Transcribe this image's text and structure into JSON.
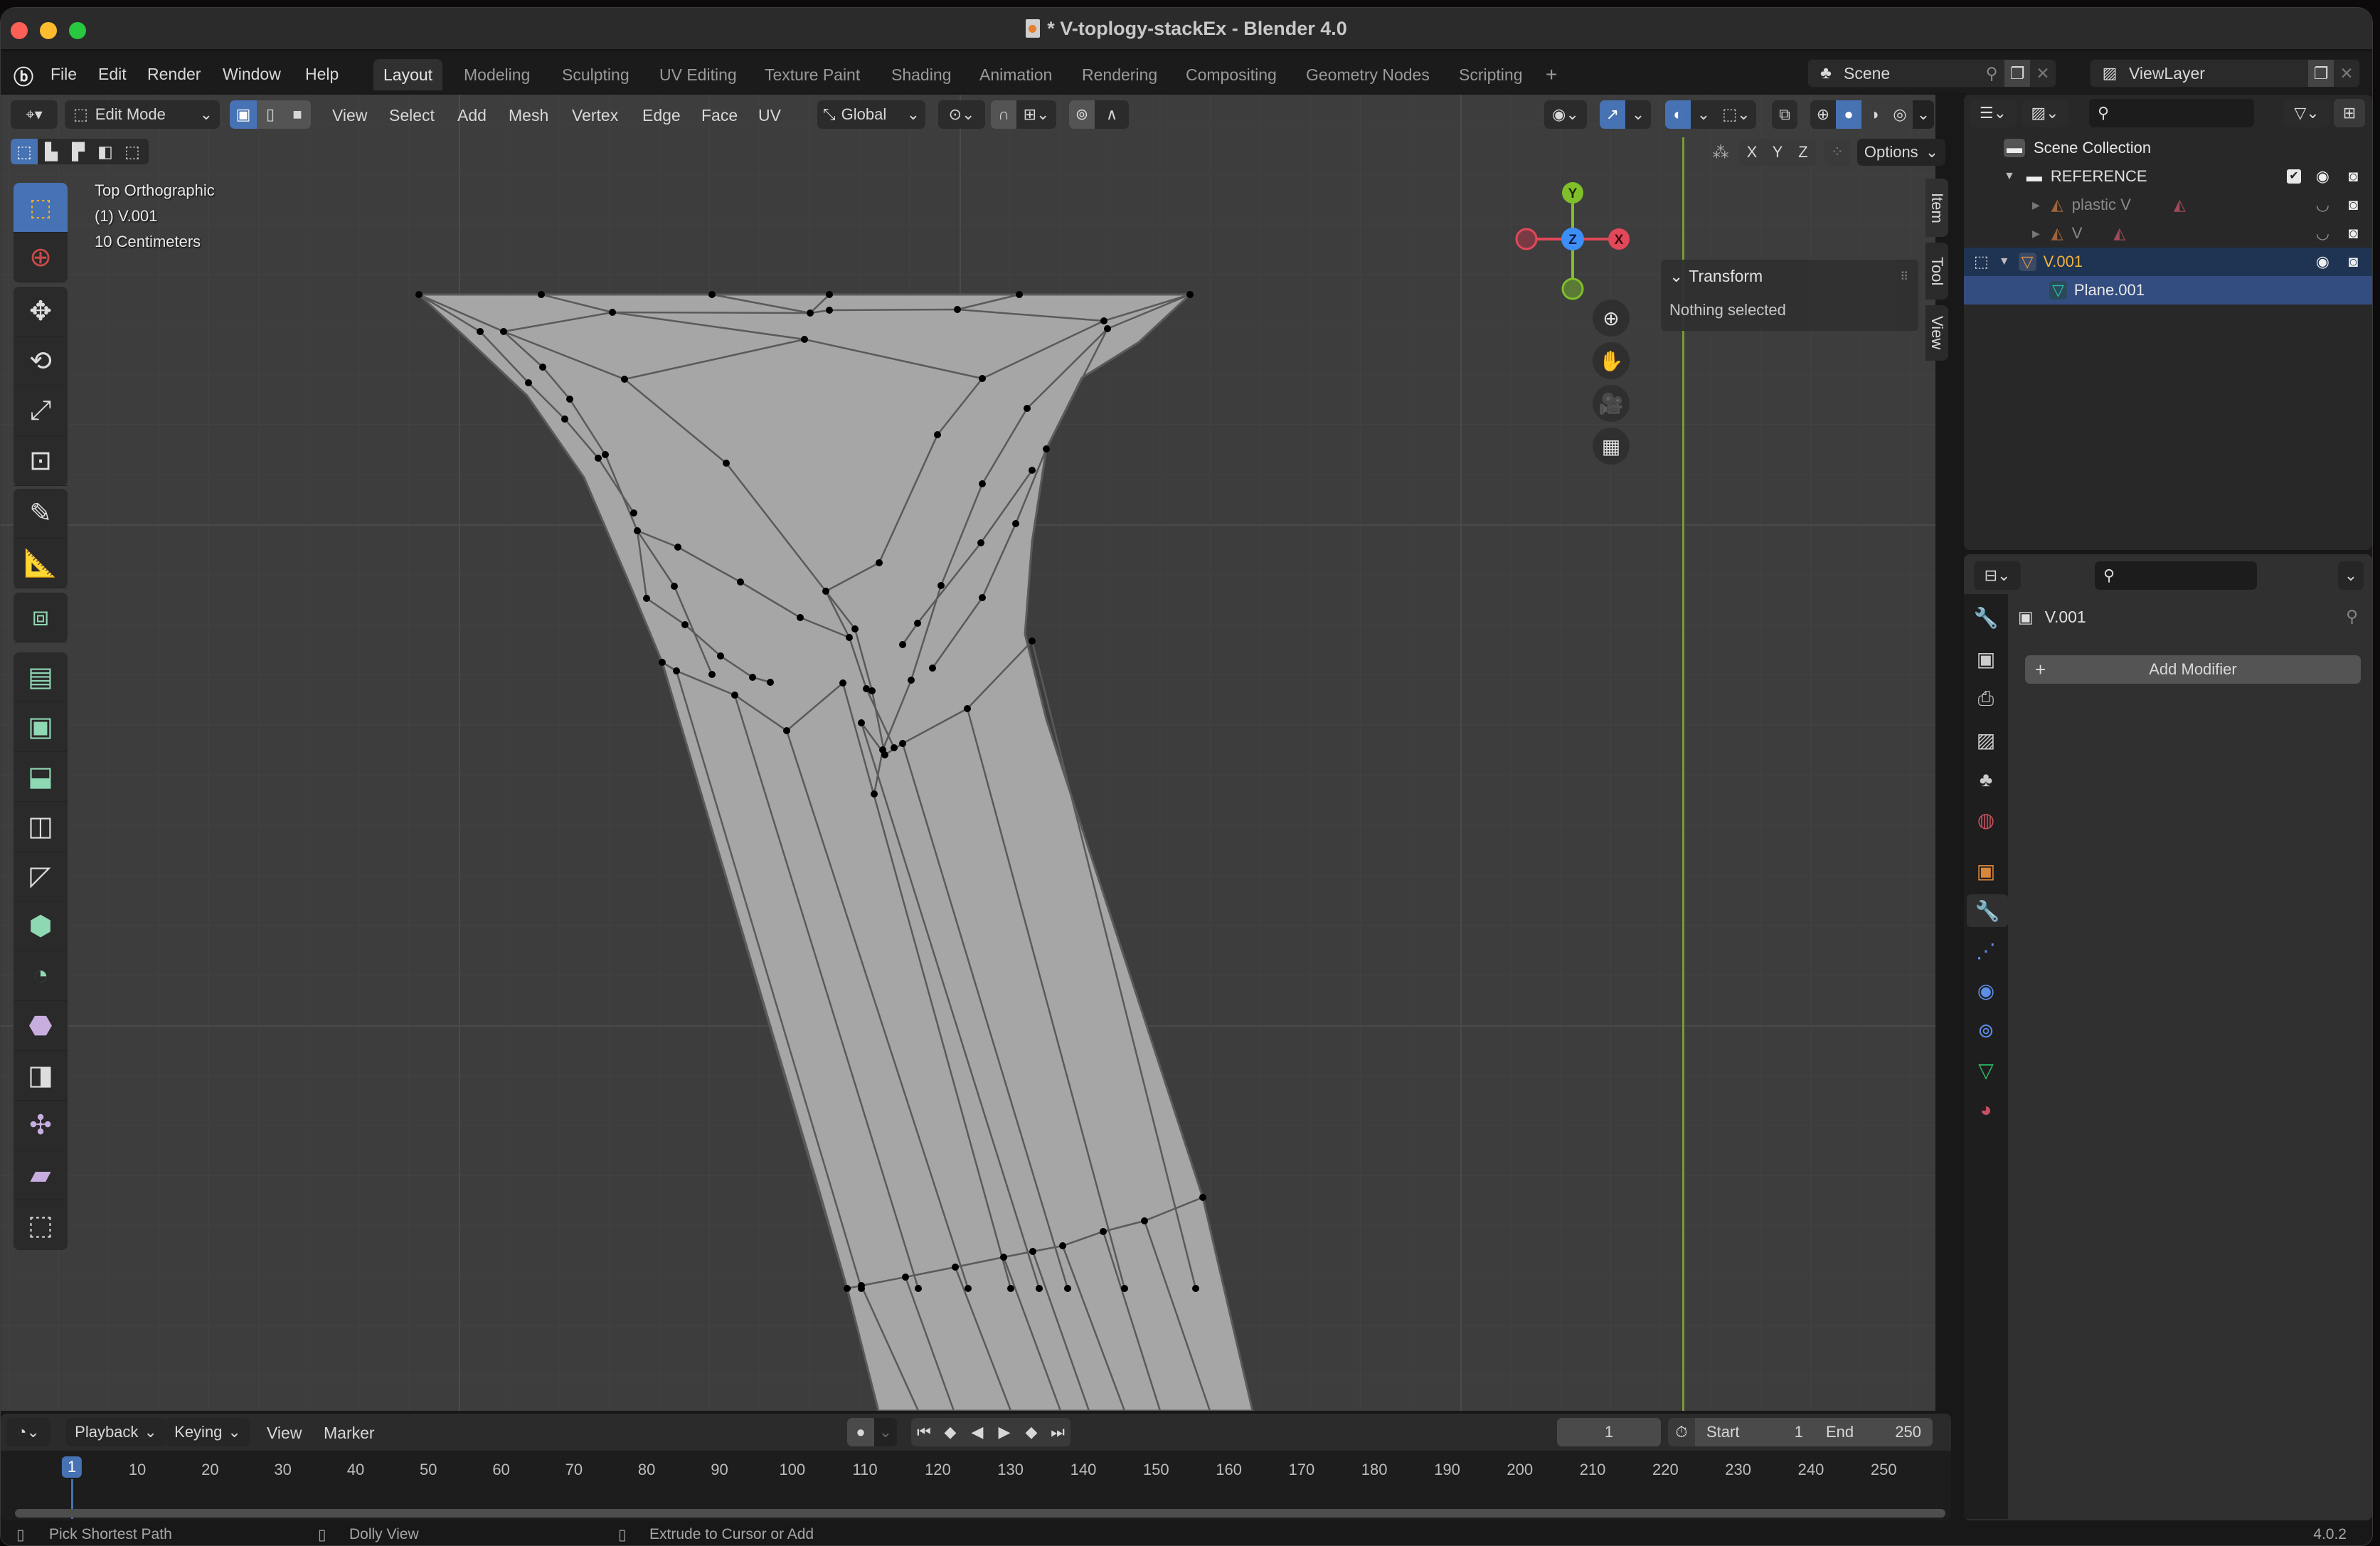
{
  "window": {
    "title": "* V-toplogy-stackEx - Blender 4.0",
    "traffic_lights": {
      "close": "#fe5f57",
      "minimize": "#febc2e",
      "maximize": "#28c840"
    }
  },
  "menubar": {
    "menus": [
      "File",
      "Edit",
      "Render",
      "Window",
      "Help"
    ],
    "workspaces": [
      "Layout",
      "Modeling",
      "Sculpting",
      "UV Editing",
      "Texture Paint",
      "Shading",
      "Animation",
      "Rendering",
      "Compositing",
      "Geometry Nodes",
      "Scripting"
    ],
    "active_workspace": "Layout",
    "add_workspace": "+",
    "scene_label": "Scene",
    "view_layer_label": "ViewLayer"
  },
  "viewport_header": {
    "mode": "Edit Mode",
    "menus": [
      "View",
      "Select",
      "Add",
      "Mesh",
      "Vertex",
      "Edge",
      "Face",
      "UV"
    ],
    "transform_orientation": "Global",
    "axis_buttons": [
      "X",
      "Y",
      "Z"
    ],
    "options_label": "Options"
  },
  "viewport": {
    "view_name": "Top Orthographic",
    "object_info": "(1) V.001",
    "grid_scale": "10 Centimeters",
    "gizmo": {
      "y": "Y",
      "z": "Z",
      "x": "X"
    },
    "colors": {
      "x": "#e1485a",
      "y": "#7fbf2a",
      "z": "#3d8ef7",
      "mesh_face": "#a6a6a6",
      "mesh_edge": "#5a5a5a",
      "vertex": "#000000",
      "y_axis_line": "#7a9a30"
    }
  },
  "tools": [
    "select-box",
    "cursor",
    "move",
    "rotate",
    "scale",
    "transform",
    "annotate",
    "measure",
    "add-cube",
    "extrude-region",
    "inset-faces",
    "bevel",
    "loop-cut",
    "knife",
    "poly-build",
    "spin",
    "smooth",
    "edge-slide",
    "shrink-fatten",
    "shear",
    "rip-region"
  ],
  "npanel": {
    "section_title": "Transform",
    "body": "Nothing selected",
    "tabs": [
      "Item",
      "Tool",
      "View"
    ]
  },
  "outliner": {
    "search_placeholder": "",
    "items": [
      {
        "label": "Scene Collection",
        "type": "scene-collection",
        "depth": 0
      },
      {
        "label": "REFERENCE",
        "type": "collection",
        "depth": 1,
        "checked": true
      },
      {
        "label": "plastic V",
        "type": "image-empty",
        "depth": 2,
        "dim": true
      },
      {
        "label": "V",
        "type": "image-empty",
        "depth": 2,
        "dim": true
      },
      {
        "label": "V.001",
        "type": "mesh-object",
        "depth": 1,
        "active": true
      },
      {
        "label": "Plane.001",
        "type": "mesh-data",
        "depth": 2,
        "selected": true
      }
    ]
  },
  "properties": {
    "object_name": "V.001",
    "add_modifier_label": "Add Modifier",
    "tabs": [
      "tool",
      "render",
      "output",
      "view-layer",
      "scene",
      "world",
      "object",
      "modifiers",
      "particles",
      "physics",
      "constraints",
      "data",
      "material"
    ],
    "active_tab": "modifiers"
  },
  "timeline": {
    "menus": [
      "Playback",
      "Keying",
      "View",
      "Marker"
    ],
    "current_frame": "1",
    "start_label": "Start",
    "start": "1",
    "end_label": "End",
    "end": "250",
    "ticks": [
      "1",
      "10",
      "20",
      "30",
      "40",
      "50",
      "60",
      "70",
      "80",
      "90",
      "100",
      "110",
      "120",
      "130",
      "140",
      "150",
      "160",
      "170",
      "180",
      "190",
      "200",
      "210",
      "220",
      "230",
      "240",
      "250"
    ]
  },
  "statusbar": {
    "left_click": "Pick Shortest Path",
    "middle_click": "Dolly View",
    "right_click": "Extrude to Cursor or Add",
    "version": "4.0.2"
  }
}
